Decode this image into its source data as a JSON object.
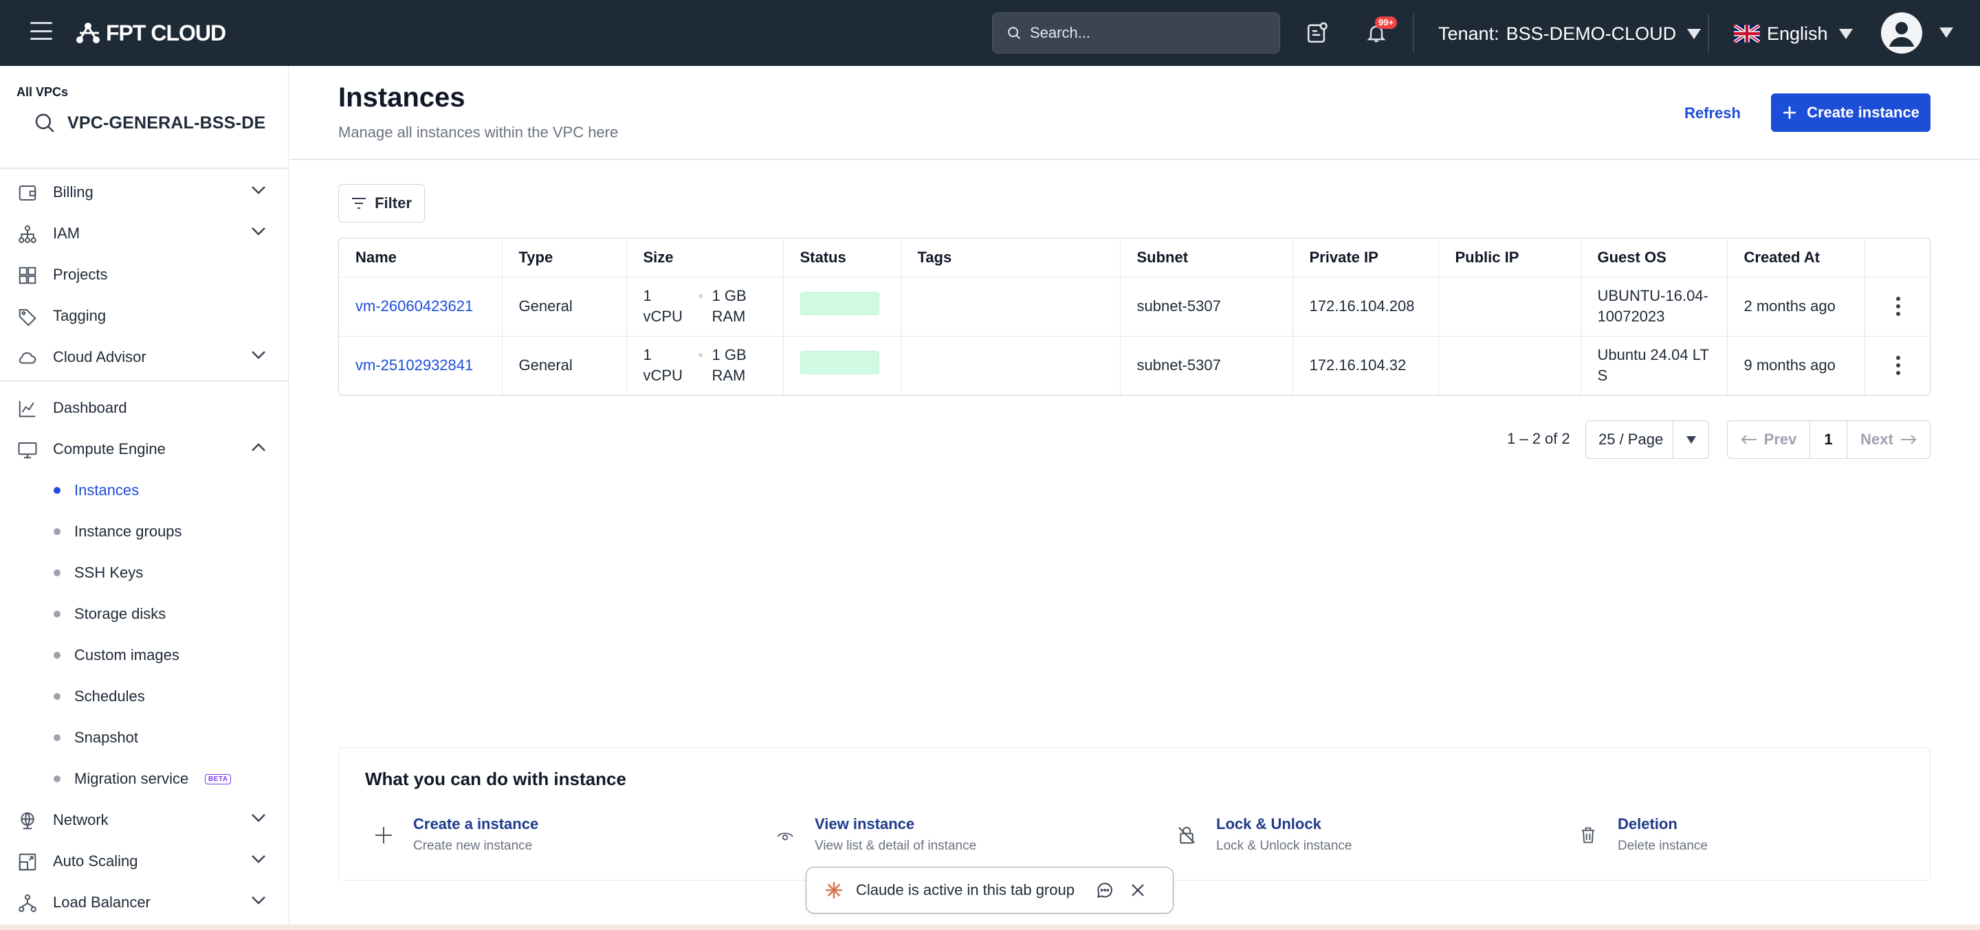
{
  "topbar": {
    "logo_text": "FPT CLOUD",
    "search_placeholder": "Search...",
    "notification_badge": "99+",
    "tenant_label": "Tenant:",
    "tenant_value": "BSS-DEMO-CLOUD",
    "language": "English"
  },
  "sidebar": {
    "vpc_label": "All VPCs",
    "vpc_name": "VPC-GENERAL-BSS-DE",
    "group1": [
      {
        "label": "Billing",
        "icon": "wallet-icon",
        "expandable": true
      },
      {
        "label": "IAM",
        "icon": "hierarchy-icon",
        "expandable": true
      },
      {
        "label": "Projects",
        "icon": "grid-icon",
        "expandable": false
      },
      {
        "label": "Tagging",
        "icon": "tag-icon",
        "expandable": false
      },
      {
        "label": "Cloud Advisor",
        "icon": "cloud-icon",
        "expandable": true
      }
    ],
    "dashboard": "Dashboard",
    "compute_engine": "Compute Engine",
    "compute_items": [
      {
        "label": "Instances",
        "active": true
      },
      {
        "label": "Instance groups"
      },
      {
        "label": "SSH Keys"
      },
      {
        "label": "Storage disks"
      },
      {
        "label": "Custom images"
      },
      {
        "label": "Schedules"
      },
      {
        "label": "Snapshot"
      },
      {
        "label": "Migration service",
        "badge": "BETA"
      }
    ],
    "network": "Network",
    "auto_scaling": "Auto Scaling",
    "load_balancer": "Load Balancer"
  },
  "main": {
    "title": "Instances",
    "subtitle": "Manage all instances within the VPC here",
    "refresh_label": "Refresh",
    "create_label": "Create instance",
    "filter_label": "Filter"
  },
  "table": {
    "columns": [
      "Name",
      "Type",
      "Size",
      "Status",
      "Tags",
      "Subnet",
      "Private IP",
      "Public IP",
      "Guest OS",
      "Created At"
    ],
    "rows": [
      {
        "name": "vm-26060423621",
        "type": "General",
        "cpu": "1 vCPU",
        "ram": "1 GB RAM",
        "tags": "",
        "subnet": "subnet-5307",
        "private_ip": "172.16.104.208",
        "public_ip": "",
        "guest_os": "UBUNTU-16.04-10072023",
        "created_at": "2 months ago"
      },
      {
        "name": "vm-25102932841",
        "type": "General",
        "cpu": "1 vCPU",
        "ram": "1 GB RAM",
        "tags": "",
        "subnet": "subnet-5307",
        "private_ip": "172.16.104.32",
        "public_ip": "",
        "guest_os": "Ubuntu 24.04 LTS",
        "created_at": "9 months ago"
      }
    ]
  },
  "pagination": {
    "count": "1 – 2 of 2",
    "page_size": "25 / Page",
    "prev": "Prev",
    "current": "1",
    "next": "Next"
  },
  "what_you_can_do": {
    "title": "What you can do with instance",
    "items": [
      {
        "title": "Create a instance",
        "subtitle": "Create new instance",
        "icon": "plus-icon"
      },
      {
        "title": "View instance",
        "subtitle": "View list & detail of instance",
        "icon": "eye-icon"
      },
      {
        "title": "Lock & Unlock",
        "subtitle": "Lock & Unlock instance",
        "icon": "lock-icon"
      },
      {
        "title": "Deletion",
        "subtitle": "Delete instance",
        "icon": "trash-icon"
      }
    ]
  },
  "claude_bar": {
    "text": "Claude is active in this tab group"
  },
  "colors": {
    "topbar_bg": "#1f2a37",
    "accent": "#1d4ed8",
    "status_pill": "#d1fae5"
  }
}
